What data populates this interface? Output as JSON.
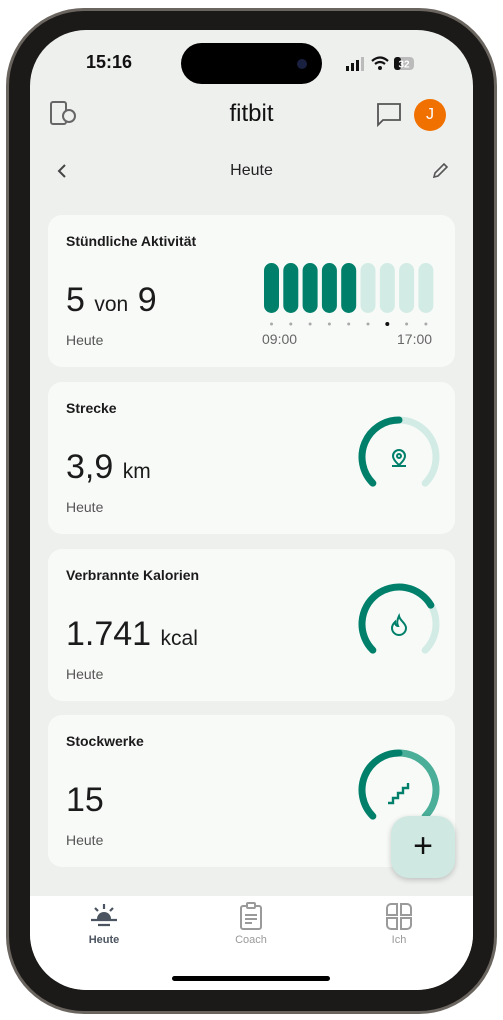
{
  "status_bar": {
    "time": "15:16",
    "battery": "32"
  },
  "header": {
    "logo": "fitbit",
    "avatar_initial": "J",
    "avatar_color": "#f07100"
  },
  "subheader": {
    "title": "Heute"
  },
  "accent": "#00806a",
  "cards": [
    {
      "title": "Stündliche Aktivität",
      "value": "5",
      "value_mid": "von",
      "value_end": "9",
      "subtitle": "Heute",
      "hours_active": 5,
      "hours_total": 9,
      "axis_start": "09:00",
      "axis_end": "17:00",
      "current_hour_index": 6
    },
    {
      "title": "Strecke",
      "value": "3,9",
      "unit": "km",
      "subtitle": "Heute",
      "progress": 0.5,
      "icon": "location-pin-icon"
    },
    {
      "title": "Verbrannte Kalorien",
      "value": "1.741",
      "unit": "kcal",
      "subtitle": "Heute",
      "progress": 0.72,
      "icon": "flame-icon"
    },
    {
      "title": "Stockwerke",
      "value": "15",
      "unit": "",
      "subtitle": "Heute",
      "progress": 1.0,
      "icon": "stairs-icon"
    }
  ],
  "fab": {
    "label": "+"
  },
  "nav": [
    {
      "label": "Heute",
      "active": true
    },
    {
      "label": "Coach",
      "active": false
    },
    {
      "label": "Ich",
      "active": false
    }
  ]
}
